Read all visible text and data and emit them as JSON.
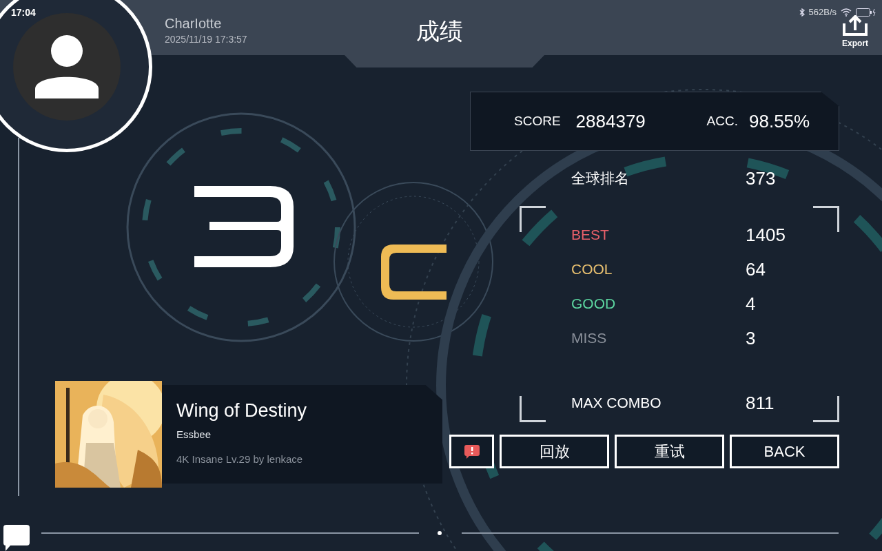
{
  "status_bar": {
    "time": "17:04",
    "network_speed": "562B/s"
  },
  "player": {
    "name": "CharIotte",
    "date": "2025/11/19 17:3:57"
  },
  "title": "成绩",
  "export_label": "Export",
  "score": {
    "score_label": "SCORE",
    "score": "2884379",
    "acc_label": "ACC.",
    "acc": "98.55%"
  },
  "stats": [
    {
      "kind": "rank",
      "label": "全球排名",
      "value": "373"
    },
    {
      "kind": "judgement",
      "label": "BEST",
      "value": "1405",
      "color": "#e8606a"
    },
    {
      "kind": "judgement",
      "label": "COOL",
      "value": "64",
      "color": "#e8c070"
    },
    {
      "kind": "judgement",
      "label": "GOOD",
      "value": "4",
      "color": "#5cd6a0"
    },
    {
      "kind": "judgement",
      "label": "MISS",
      "value": "3",
      "color": "#8a909a"
    },
    {
      "kind": "combo",
      "label": "MAX COMBO",
      "value": "811"
    }
  ],
  "song": {
    "title": "Wing of Destiny",
    "artist": "Essbee",
    "chart": "4K Insane Lv.29 by lenkace"
  },
  "buttons": [
    {
      "kind": "report"
    },
    {
      "kind": "text",
      "label": "回放"
    },
    {
      "kind": "text",
      "label": "重试"
    },
    {
      "kind": "text",
      "label": "BACK"
    }
  ]
}
